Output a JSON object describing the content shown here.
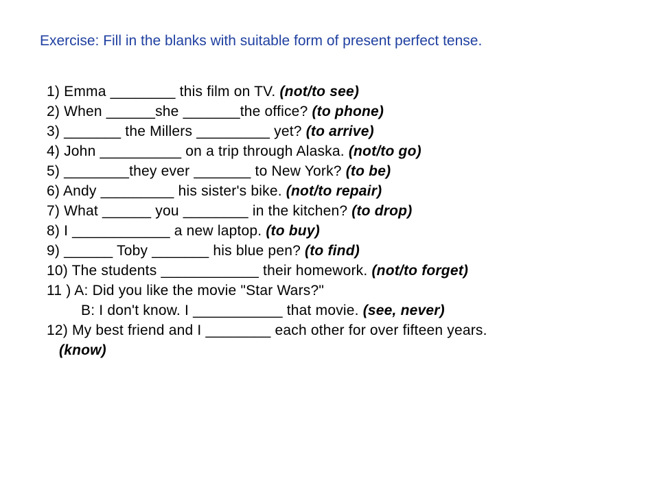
{
  "title": "Exercise: Fill in the blanks with suitable form of present perfect tense.",
  "items": {
    "q1": {
      "text": "1) Emma ________ this film on TV. ",
      "hint": "(not/to see)"
    },
    "q2": {
      "text": "2) When ______she _______the office? ",
      "hint": "(to phone)"
    },
    "q3": {
      "text": "3) _______ the Millers _________ yet? ",
      "hint": "(to arrive)"
    },
    "q4": {
      "text": "4) John __________ on a trip through Alaska. ",
      "hint": "(not/to go)"
    },
    "q5": {
      "text": "5) ________they ever _______ to New York? ",
      "hint": "(to be)"
    },
    "q6": {
      "text": "6) Andy _________ his sister's bike. ",
      "hint": "(not/to repair)"
    },
    "q7": {
      "text": "7) What ______ you ________ in the kitchen? ",
      "hint": "(to drop)"
    },
    "q8": {
      "text": "8) I ____________ a new laptop. ",
      "hint": "(to buy)"
    },
    "q9": {
      "text": "9) ______ Toby _______ his blue pen? ",
      "hint": "(to find)"
    },
    "q10": {
      "text": "10) The students ____________ their homework. ",
      "hint": "(not/to forget)"
    },
    "q11a": {
      "text": "11 )  A: Did you like the movie \"Star Wars?\""
    },
    "q11b": {
      "text": "B: I don't know. I ___________ that movie. ",
      "hint": "(see, never)"
    },
    "q12a": {
      "text": "12)   My best friend and I ________ each other for over fifteen years."
    },
    "q12b": {
      "hint": "(know)"
    }
  }
}
